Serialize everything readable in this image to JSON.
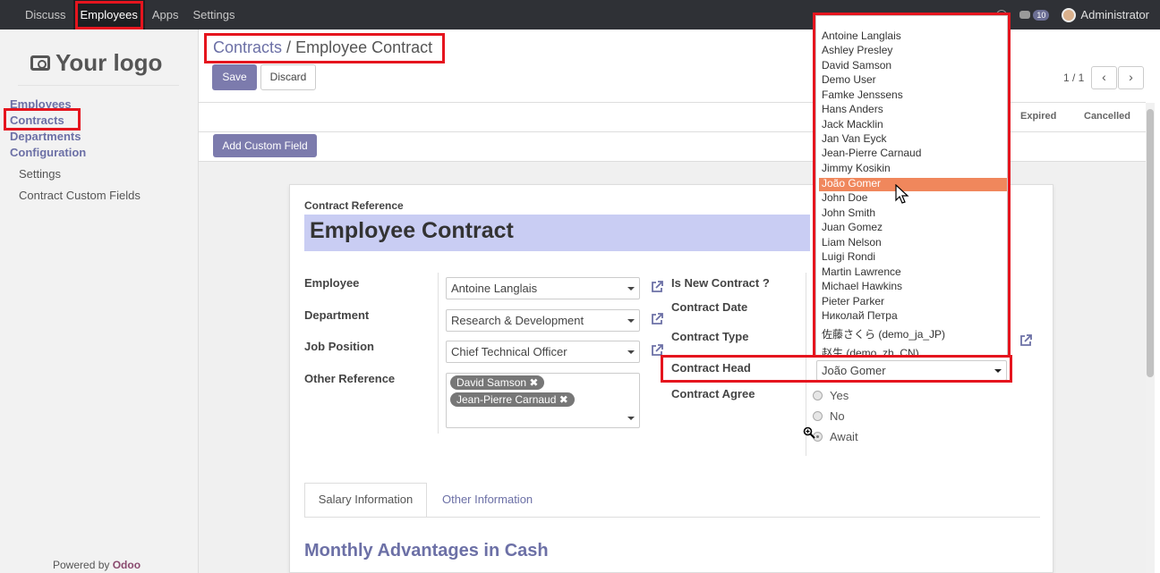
{
  "navbar": {
    "items": [
      "Discuss",
      "Employees",
      "Apps",
      "Settings"
    ],
    "chat_count": "10",
    "user": "Administrator"
  },
  "sidebar": {
    "logo": "Your logo",
    "menu": [
      "Employees",
      "Contracts",
      "Departments",
      "Configuration"
    ],
    "submenu": [
      "Settings",
      "Contract Custom Fields"
    ],
    "powered_by": "Powered by",
    "powered_brand": "Odoo"
  },
  "breadcrumb": {
    "parent": "Contracts",
    "sep": "/",
    "current": "Employee Contract"
  },
  "buttons": {
    "save": "Save",
    "discard": "Discard",
    "add_custom_field": "Add Custom Field"
  },
  "pager": {
    "value": "1 / 1",
    "prev": "‹",
    "next": "›"
  },
  "statusbar": [
    "Expired",
    "Cancelled"
  ],
  "form": {
    "reference_label": "Contract Reference",
    "reference_value": "Employee Contract",
    "employee_label": "Employee",
    "employee_value": "Antoine Langlais",
    "department_label": "Department",
    "department_value": "Research & Development",
    "job_label": "Job Position",
    "job_value": "Chief Technical Officer",
    "other_ref_label": "Other Reference",
    "other_ref_tags": [
      "David Samson ✖",
      "Jean-Pierre Carnaud ✖"
    ],
    "is_new_label": "Is New Contract ?",
    "date_label": "Contract Date",
    "type_label": "Contract Type",
    "head_label": "Contract Head",
    "head_value": "João Gomer",
    "agree_label": "Contract Agree",
    "agree_options": [
      "Yes",
      "No",
      "Await"
    ],
    "tabs": [
      "Salary Information",
      "Other Information"
    ],
    "section_title": "Monthly Advantages in Cash"
  },
  "dropdown": {
    "items": [
      "Antoine Langlais",
      "Ashley Presley",
      "David Samson",
      "Demo User",
      "Famke Jenssens",
      "Hans Anders",
      "Jack Macklin",
      "Jan Van Eyck",
      "Jean-Pierre Carnaud",
      "Jimmy Kosikin",
      "João Gomer",
      "John Doe",
      "John Smith",
      "Juan Gomez",
      "Liam Nelson",
      "Luigi Rondi",
      "Martin Lawrence",
      "Michael Hawkins",
      "Pieter Parker",
      "Николай Петра",
      "佐藤さくら (demo_ja_JP)",
      "赵生 (demo_zh_CN)"
    ],
    "highlighted": "João Gomer"
  },
  "colors": {
    "accent": "#7c7bad",
    "highlight": "#f0875c",
    "annotation": "#e5151e"
  }
}
